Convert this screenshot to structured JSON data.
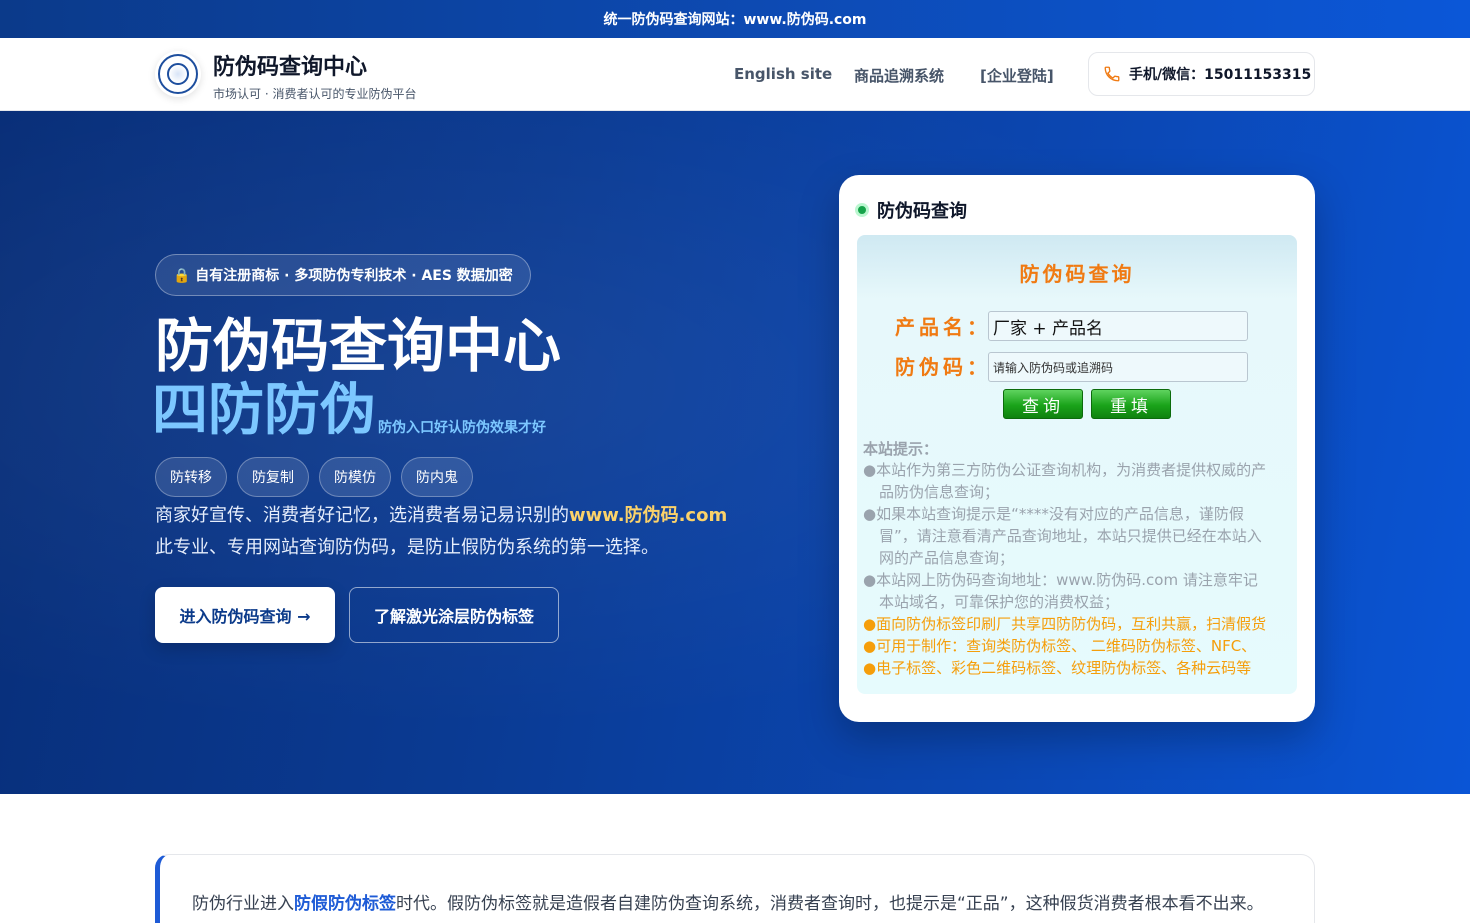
{
  "topbar": {
    "text": "统一防伪码查询网站：www.防伪码.com"
  },
  "header": {
    "logo_icon": "seal-logo-icon",
    "brand_title": "防伪码查询中心",
    "brand_subtitle": "市场认可 · 消费者认可的专业防伪平台",
    "nav": [
      "English site",
      "商品追溯系统",
      "[企业登陆]"
    ],
    "phone_label": "手机/微信：15011153315",
    "phone_icon": "phone-icon"
  },
  "hero": {
    "badge": "🔒 自有注册商标 · 多项防伪专利技术 · AES 数据加密",
    "title": "防伪码查询中心",
    "big_text": "四防防伪",
    "small_text": "防伪入口好认防伪效果才好",
    "tags": [
      "防转移",
      "防复制",
      "防模仿",
      "防内鬼"
    ],
    "desc1_prefix": "商家好宣传、消费者好记忆，选消费者易记易识别的",
    "desc1_highlight": "www.防伪码.com",
    "desc2": "此专业、专用网站查询防伪码，是防止假防伪系统的第一选择。",
    "btn_primary": "进入防伪码查询 →",
    "btn_secondary": "了解激光涂层防伪标签"
  },
  "query_card": {
    "title": "防伪码查询",
    "panel_title": "防伪码查询",
    "product_label": "产品名：",
    "product_value": "厂家 + 产品名",
    "code_label": "防伪码：",
    "code_placeholder": "请输入防伪码或追溯码",
    "query_button": "查询",
    "reset_button": "重填",
    "tips_title": "本站提示：",
    "tips_gray": [
      "●本站作为第三方防伪公证查询机构，为消费者提供权威的产",
      "品防伪信息查询；",
      "●如果本站查询提示是“****没有对应的产品信息，谨防假",
      "冒”，请注意看清产品查询地址，本站只提供已经在本站入",
      "网的产品信息查询；",
      "●本站网上防伪码查询地址：www.防伪码.com 请注意牢记",
      "本站域名，可靠保护您的消费权益；"
    ],
    "tips_orange": [
      "●面向防伪标签印刷厂共享四防防伪码，互利共赢，扫清假货",
      "●可用于制作：查询类防伪标签、 二维码防伪标签、NFC、",
      "●电子标签、彩色二维码标签、纹理防伪标签、各种云码等"
    ]
  },
  "content": {
    "prefix": "防伪行业进入",
    "highlight": "防假防伪标签",
    "suffix": "时代。假防伪标签就是造假者自建防伪查询系统，消费者查询时，也提示是“正品”，这种假货消费者根本看不出来。"
  },
  "colors": {
    "accent_blue": "#0b47b3",
    "orange": "#f07a12",
    "green": "#16a34a",
    "highlight_yellow": "#fbd26a",
    "light_blue": "#7cc7ff"
  }
}
